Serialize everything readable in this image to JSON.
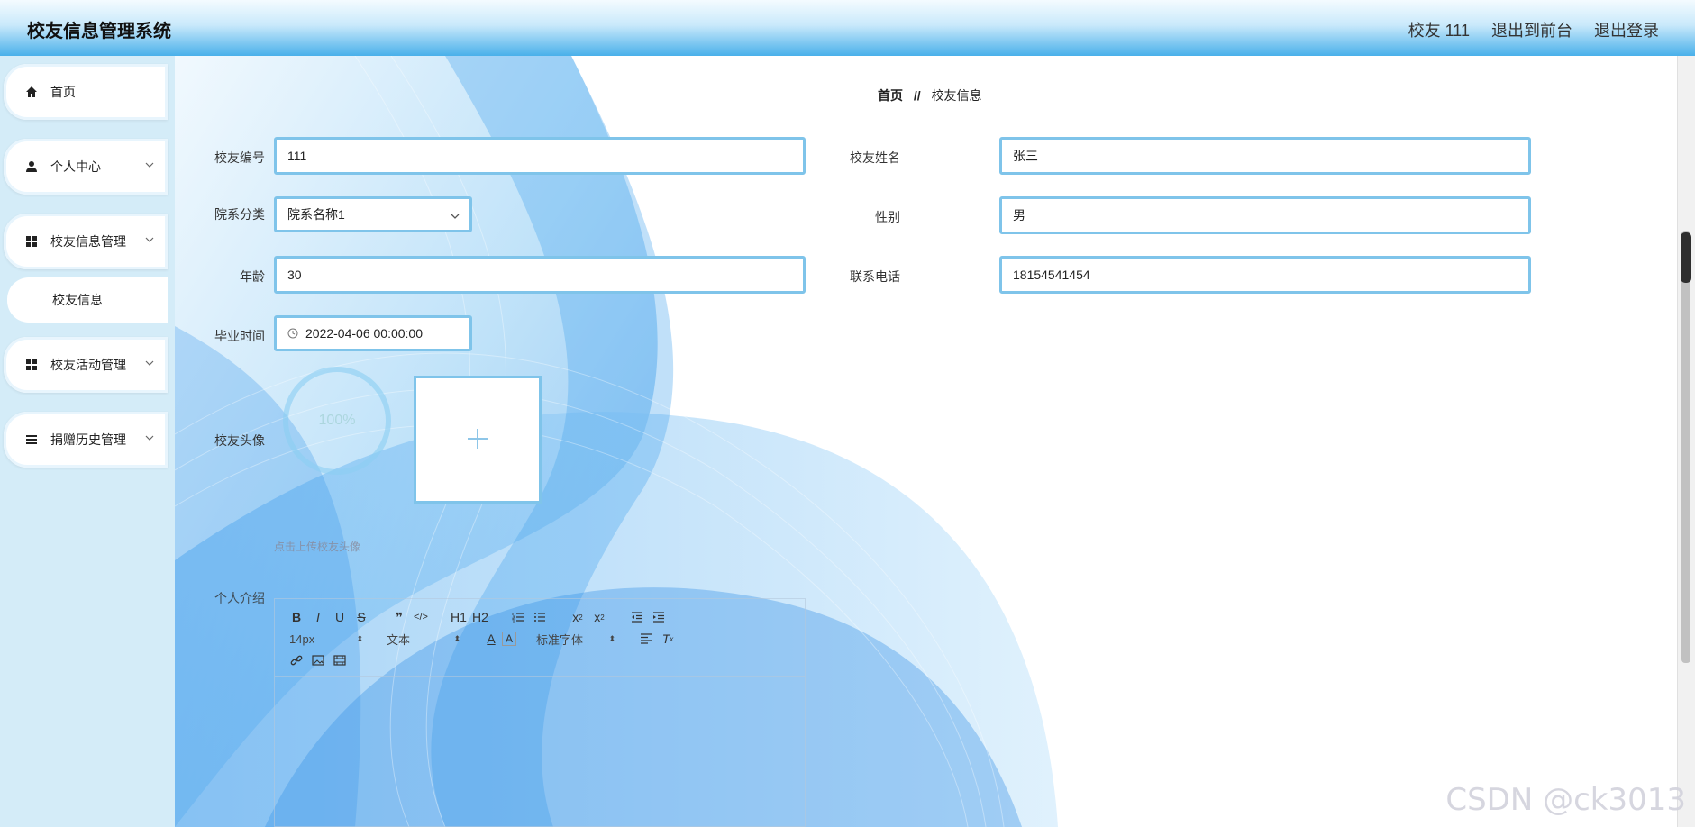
{
  "header": {
    "title": "校友信息管理系统",
    "user_label": "校友 111",
    "front_label": "退出到前台",
    "logout_label": "退出登录"
  },
  "sidebar": {
    "items": [
      {
        "label": "首页",
        "icon": "home-icon"
      },
      {
        "label": "个人中心",
        "icon": "user-icon"
      },
      {
        "label": "校友信息管理",
        "icon": "grid-icon"
      },
      {
        "label": "校友信息"
      },
      {
        "label": "校友活动管理",
        "icon": "grid-icon"
      },
      {
        "label": "捐赠历史管理",
        "icon": "list-icon"
      }
    ]
  },
  "breadcrumb": {
    "home": "首页",
    "sep": "//",
    "current": "校友信息"
  },
  "form": {
    "alumni_no": {
      "label": "校友编号",
      "value": "111"
    },
    "alumni_name": {
      "label": "校友姓名",
      "value": "张三"
    },
    "department": {
      "label": "院系分类",
      "value": "院系名称1"
    },
    "gender": {
      "label": "性别",
      "value": "男"
    },
    "age": {
      "label": "年龄",
      "value": "30"
    },
    "phone": {
      "label": "联系电话",
      "value": "18154541454"
    },
    "grad_time": {
      "label": "毕业时间",
      "value": "2022-04-06 00:00:00"
    },
    "avatar": {
      "label": "校友头像",
      "progress": "100%",
      "hint": "点击上传校友头像"
    },
    "intro": {
      "label": "个人介绍"
    }
  },
  "editor": {
    "font_size": "14px",
    "text_type": "文本",
    "font_family": "标准字体",
    "h1": "H1",
    "h2": "H2"
  },
  "watermark": "CSDN @ck3013",
  "colors": {
    "accent": "#49b0ea",
    "border": "#7fc4ea",
    "sidebar": "#d4ecf8"
  }
}
